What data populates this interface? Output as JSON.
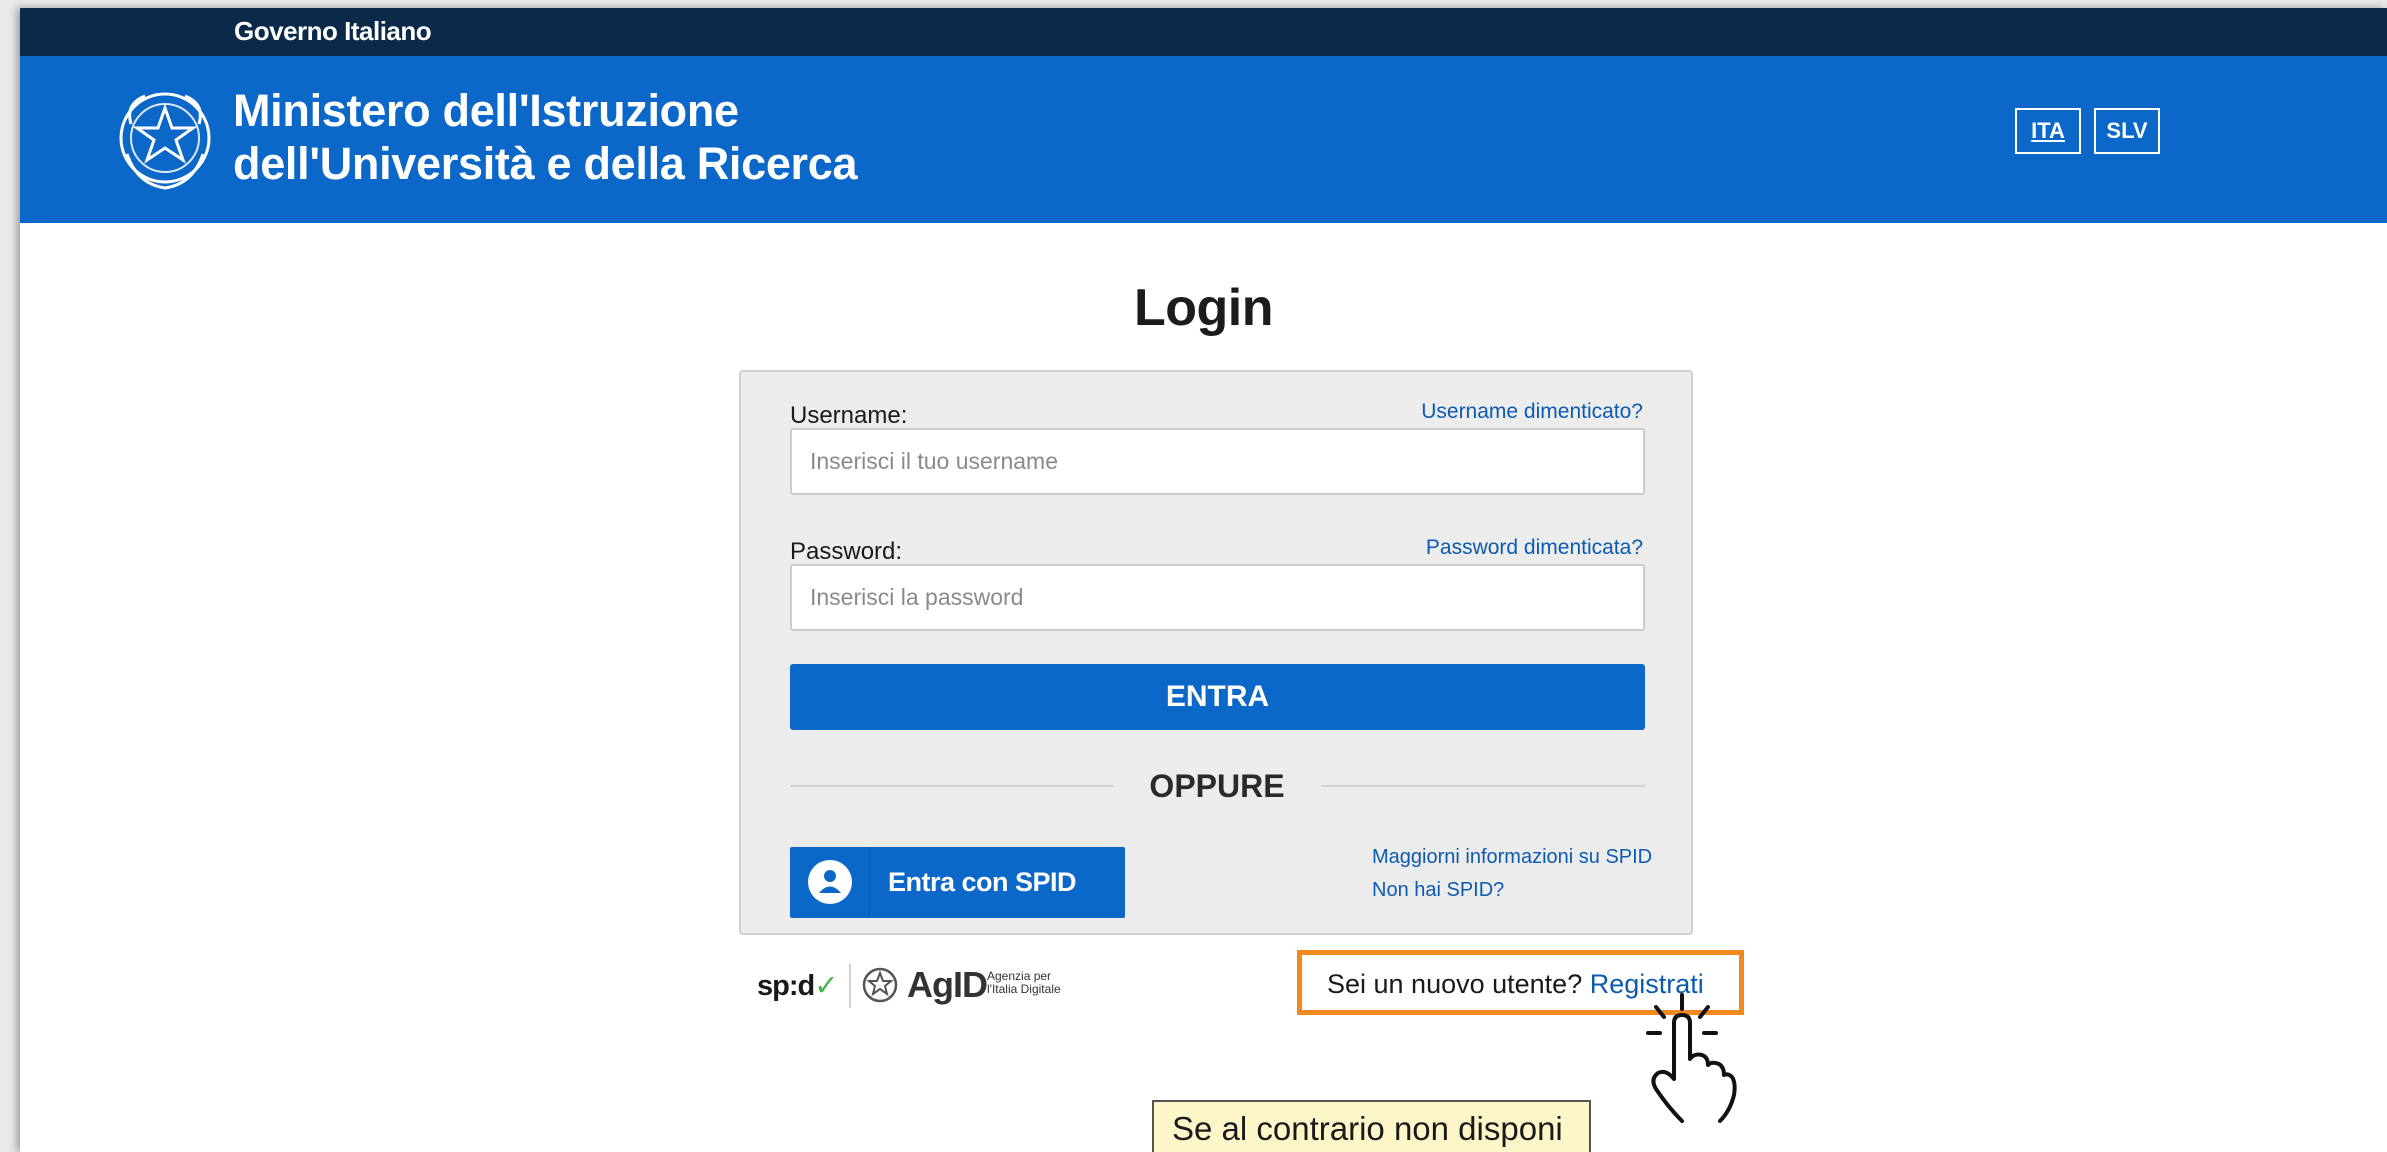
{
  "gov_bar": {
    "label": "Governo Italiano"
  },
  "header": {
    "title_line1": "Ministero dell'Istruzione",
    "title_line2": "dell'Università e della Ricerca",
    "emblem_icon": "italian-emblem-icon",
    "languages": [
      {
        "label": "ITA",
        "active": true
      },
      {
        "label": "SLV",
        "active": false
      }
    ]
  },
  "login": {
    "title": "Login",
    "username_label": "Username:",
    "username_placeholder": "Inserisci il tuo username",
    "username_forgot": "Username dimenticato?",
    "password_label": "Password:",
    "password_placeholder": "Inserisci la password",
    "password_forgot": "Password dimenticata?",
    "submit_label": "ENTRA",
    "separator": "OPPURE",
    "spid_button": "Entra con SPID",
    "spid_info_link": "Maggiorni informazioni su SPID",
    "no_spid_link": "Non hai SPID?"
  },
  "footer_logos": {
    "spid_text": "sp:d",
    "spid_check": "✓",
    "agid_text": "AgID",
    "agid_sub": "Agenzia per l'Italia Digitale"
  },
  "register": {
    "question": "Sei un nuovo utente?",
    "link": "Registrati"
  },
  "tooltip": {
    "text": "Se al contrario non disponi"
  },
  "colors": {
    "gov_bar": "#0b2a4a",
    "header_blue": "#0c68c8",
    "link_blue": "#0c5bb0",
    "highlight_orange": "#f08a1c",
    "tooltip_bg": "#fdf6c8"
  }
}
